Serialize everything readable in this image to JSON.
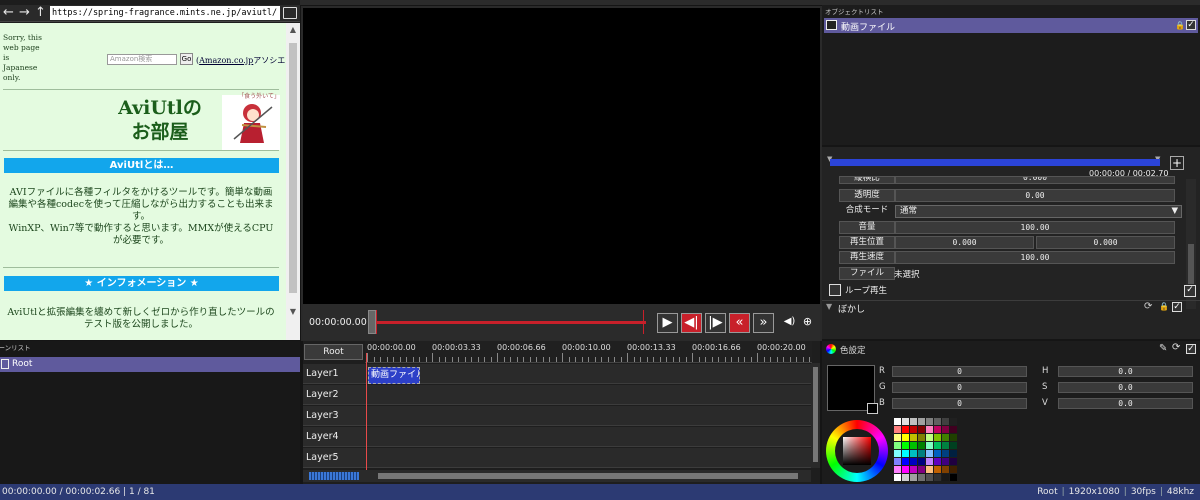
{
  "browser": {
    "url": "https://spring-fragrance.mints.ne.jp/aviutl/",
    "sorry_text": "Sorry, this web page is Japanese only.",
    "amazon_placeholder": "Amazon検索",
    "amazon_go": "Go",
    "amazon_link": "Amazon.co.jp",
    "amazon_link_suffix": "アソシエイト)",
    "amazon_link_prefix": "(",
    "site_title_1": "AviUtlの",
    "site_title_2": "お部屋",
    "chara_caption": "「食う外いて」",
    "section1": "AviUtlとは…",
    "para1": "AVIファイルに各種フィルタをかけるツールです。簡単な動画編集や各種codecを使って圧縮しながら出力することも出来ます。",
    "para2": "WinXP、Win7等で動作すると思います。MMXが使えるCPUが必要です。",
    "section2": "★ インフォメーション ★",
    "para3": "AviUtlと拡張編集を纏めて新しくゼロから作り直したツールのテスト版を公開しました。"
  },
  "preview": {
    "current_time": "00:00:00.00"
  },
  "object_list": {
    "title": "オブジェクトリスト",
    "item_label": "動画ファイル"
  },
  "properties": {
    "time": "00:00:00 / 00:02.70",
    "rows": {
      "scale_label": "縦横比",
      "scale_value": "0.000",
      "opacity_label": "透明度",
      "opacity_value": "0.00",
      "blend_label": "合成モード",
      "blend_value": "通常",
      "volume_label": "音量",
      "volume_value": "100.00",
      "pos_label": "再生位置",
      "pos_value_a": "0.000",
      "pos_value_b": "0.000",
      "speed_label": "再生速度",
      "speed_value": "100.00",
      "file_label": "ファイル",
      "file_value": "未選択",
      "loop_label": "ループ再生"
    },
    "blur_label": "ぼかし"
  },
  "scene_list": {
    "title": "シーンリスト",
    "item_label": "Root"
  },
  "timeline": {
    "root_button": "Root",
    "ticks": [
      "00:00:00.00",
      "00:00:03.33",
      "00:00:06.66",
      "00:00:10.00",
      "00:00:13.33",
      "00:00:16.66",
      "00:00:20.00"
    ],
    "layers": [
      "Layer1",
      "Layer2",
      "Layer3",
      "Layer4",
      "Layer5"
    ],
    "clip_label": "動画ファイル"
  },
  "color": {
    "title": "色設定",
    "r_label": "R",
    "r_value": "0",
    "g_label": "G",
    "g_value": "0",
    "b_label": "B",
    "b_value": "0",
    "h_label": "H",
    "h_value": "0.0",
    "s_label": "S",
    "s_value": "0.0",
    "v_label": "V",
    "v_value": "0.0",
    "current_hex": "#000000"
  },
  "status": {
    "left": "00:00:00.00 / 00:00:02.66 | 1 / 81",
    "scene": "Root",
    "resolution": "1920x1080",
    "fps": "30fps",
    "audio": "48khz"
  },
  "colors": {
    "selection": "#5f5a9d",
    "status_bar": "#2c3a73",
    "seek_red": "#c8202a",
    "clip_blue": "#2d40c8",
    "web_bg": "#e4fbe0",
    "web_heading_bar": "#12a6ec"
  }
}
